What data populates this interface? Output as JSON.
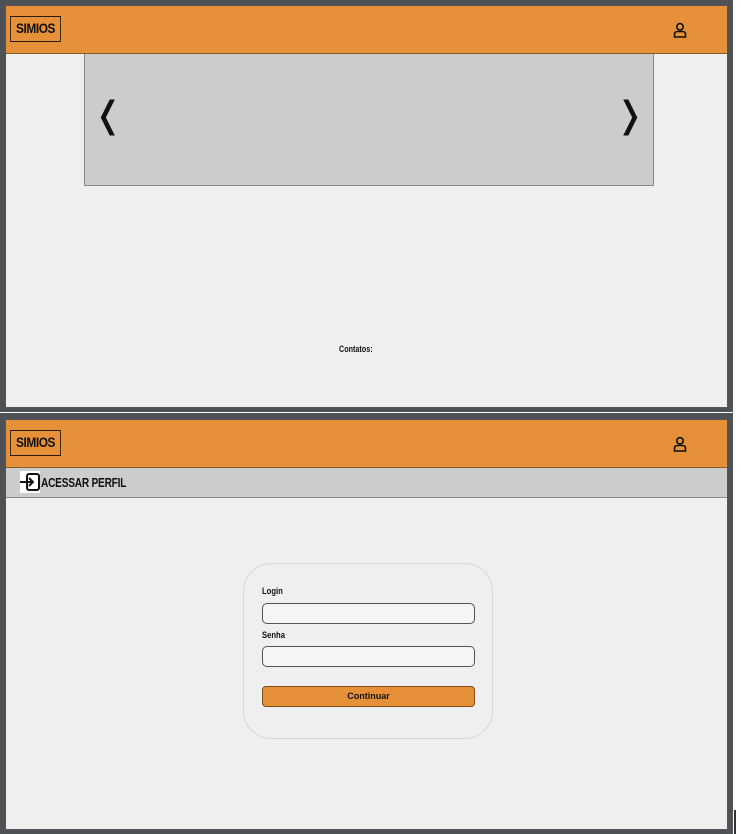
{
  "screen1": {
    "header": {
      "logo": "SIMIOS",
      "user_icon": "user-icon"
    },
    "carousel": {
      "prev": "❬",
      "next": "❭"
    },
    "footer": {
      "contacts_label": "Contatos:"
    }
  },
  "screen2": {
    "header": {
      "logo": "SIMIOS",
      "user_icon": "user-icon"
    },
    "subbar": {
      "icon": "enter-icon",
      "label": "ACESSAR PERFIL"
    },
    "login": {
      "login_label": "Login",
      "login_value": "",
      "password_label": "Senha",
      "password_value": "",
      "continue_label": "Continuar"
    }
  },
  "colors": {
    "accent": "#e6913a",
    "page_bg": "#efefef",
    "carousel_bg": "#cccccc",
    "frame_border": "#4e5257"
  }
}
